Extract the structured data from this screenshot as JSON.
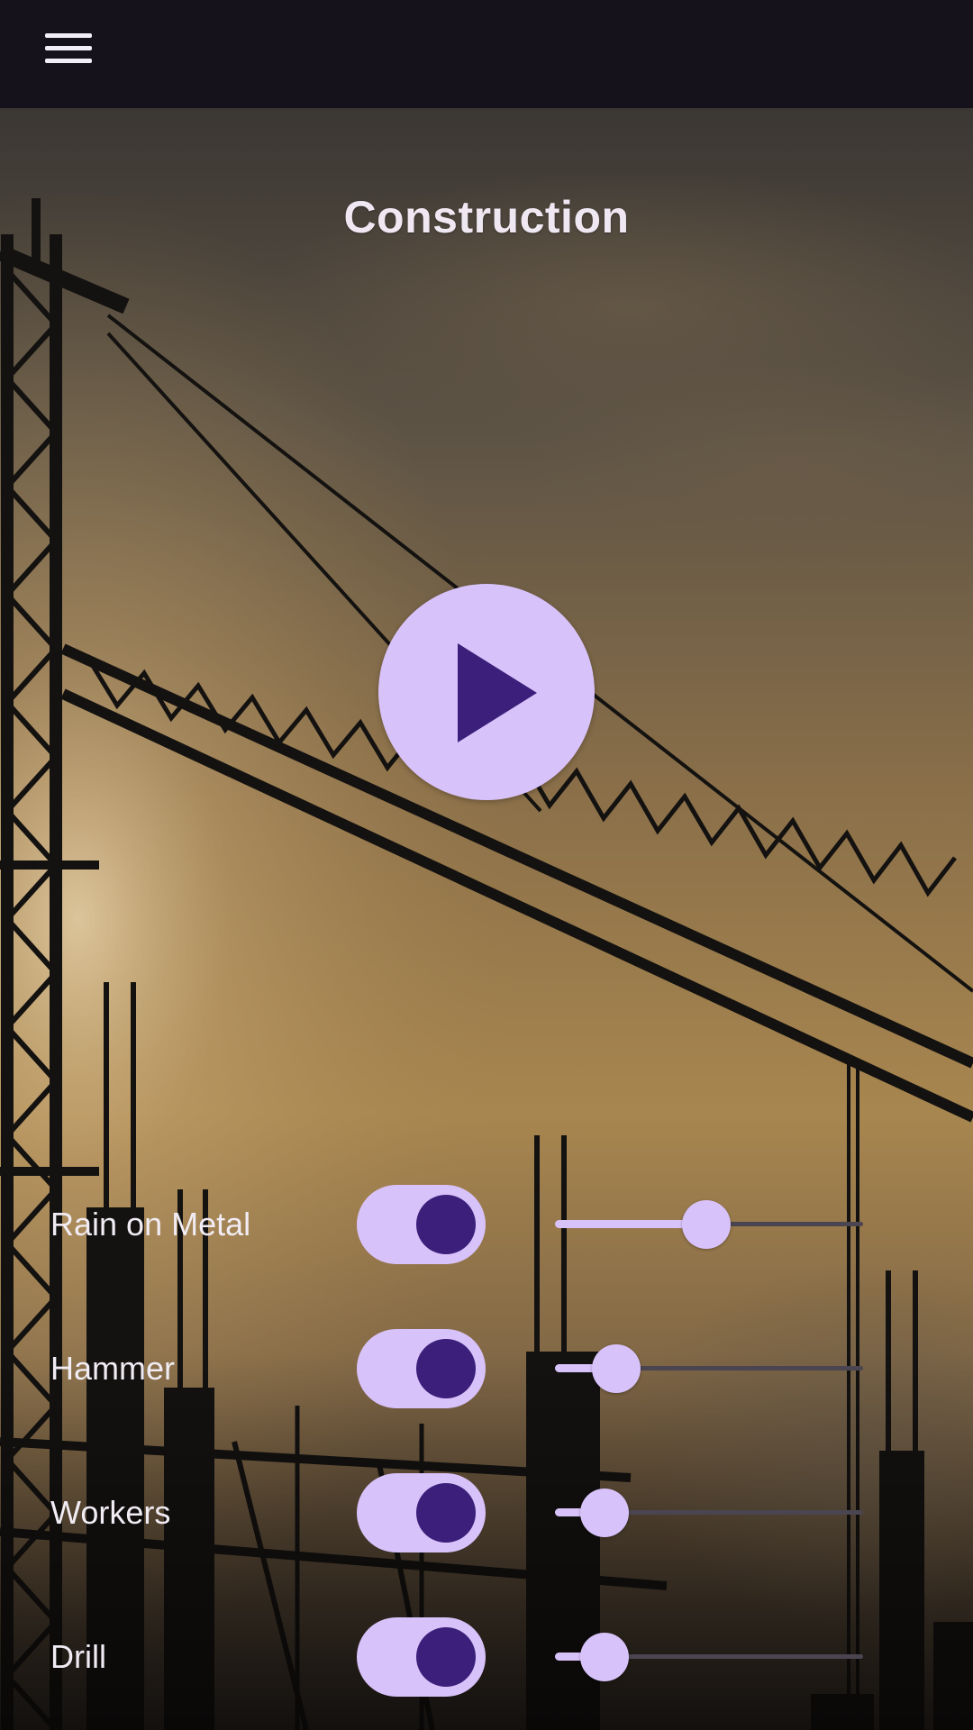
{
  "app": {
    "menu_icon": "hamburger-menu-icon",
    "background_image": "construction-crane-sunset",
    "play_icon": "play-icon"
  },
  "scene": {
    "title": "Construction"
  },
  "colors": {
    "top_bar": "#15121c",
    "accent_light": "#d8c2fa",
    "accent_dark": "#3b1f7a",
    "slider_track": "#4a4550",
    "label_text": "#f1ecf4"
  },
  "sounds": [
    {
      "label": "Rain on Metal",
      "enabled": true,
      "volume": 0.49
    },
    {
      "label": "Hammer",
      "enabled": true,
      "volume": 0.2
    },
    {
      "label": "Workers",
      "enabled": true,
      "volume": 0.16
    },
    {
      "label": "Drill",
      "enabled": true,
      "volume": 0.16
    }
  ]
}
